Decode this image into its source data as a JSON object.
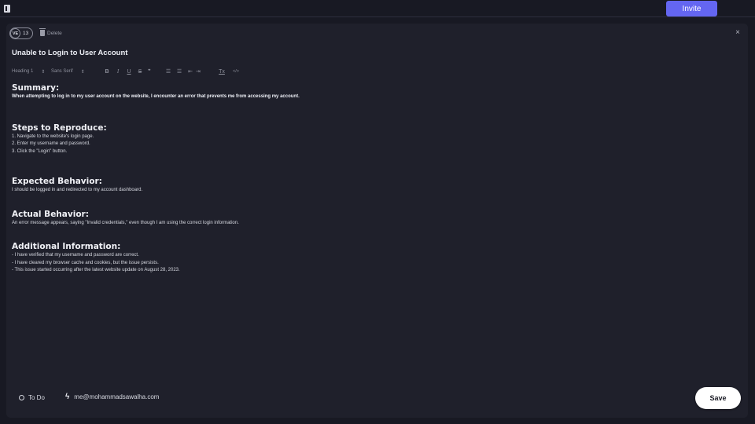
{
  "topbar": {
    "sidebar_toggle_icon": "sidebar-toggle-icon",
    "invite_label": "Invite",
    "accent_color": "#6466f1"
  },
  "header": {
    "assignee_initials": "VE",
    "issue_number": "13",
    "delete_label": "Delete",
    "close_icon": "×"
  },
  "issue": {
    "title": "Unable to Login to User Account"
  },
  "toolbar": {
    "heading_select": "Heading 1",
    "font_select": "Sans Serif",
    "select_arrows": "⇕",
    "bold": "B",
    "italic": "I",
    "underline": "U",
    "strike": "S",
    "quote": "❞",
    "ordered_list": "☰",
    "bullet_list": "☰",
    "indent_decrease": "⇤",
    "indent_increase": "⇥",
    "clear_format": "Tx",
    "code": "</>"
  },
  "body": {
    "sections": [
      {
        "heading": "Summary:",
        "lines": [
          "When attempting to log in to my user account on the website, I encounter an error that prevents me from accessing my account."
        ]
      },
      {
        "heading": "Steps to Reproduce:",
        "lines": [
          "1. Navigate to the website's login page.",
          "2. Enter my username and password.",
          "3. Click the \"Login\" button."
        ]
      },
      {
        "heading": "Expected Behavior:",
        "lines": [
          "I should be logged in and redirected to my account dashboard."
        ]
      },
      {
        "heading": "Actual Behavior:",
        "lines": [
          "An error message appears, saying \"Invalid credentials,\" even though I am using the correct login information."
        ]
      },
      {
        "heading": "Additional Information:",
        "lines": [
          "- I have verified that my username and password are correct.",
          "- I have cleared my browser cache and cookies, but the issue persists.",
          "- This issue started occurring after the latest website update on August 28, 2023."
        ]
      }
    ]
  },
  "footer": {
    "status_label": "To Do",
    "user_email": "me@mohammadsawalha.com",
    "bolt_icon": "ϟ",
    "save_label": "Save"
  }
}
